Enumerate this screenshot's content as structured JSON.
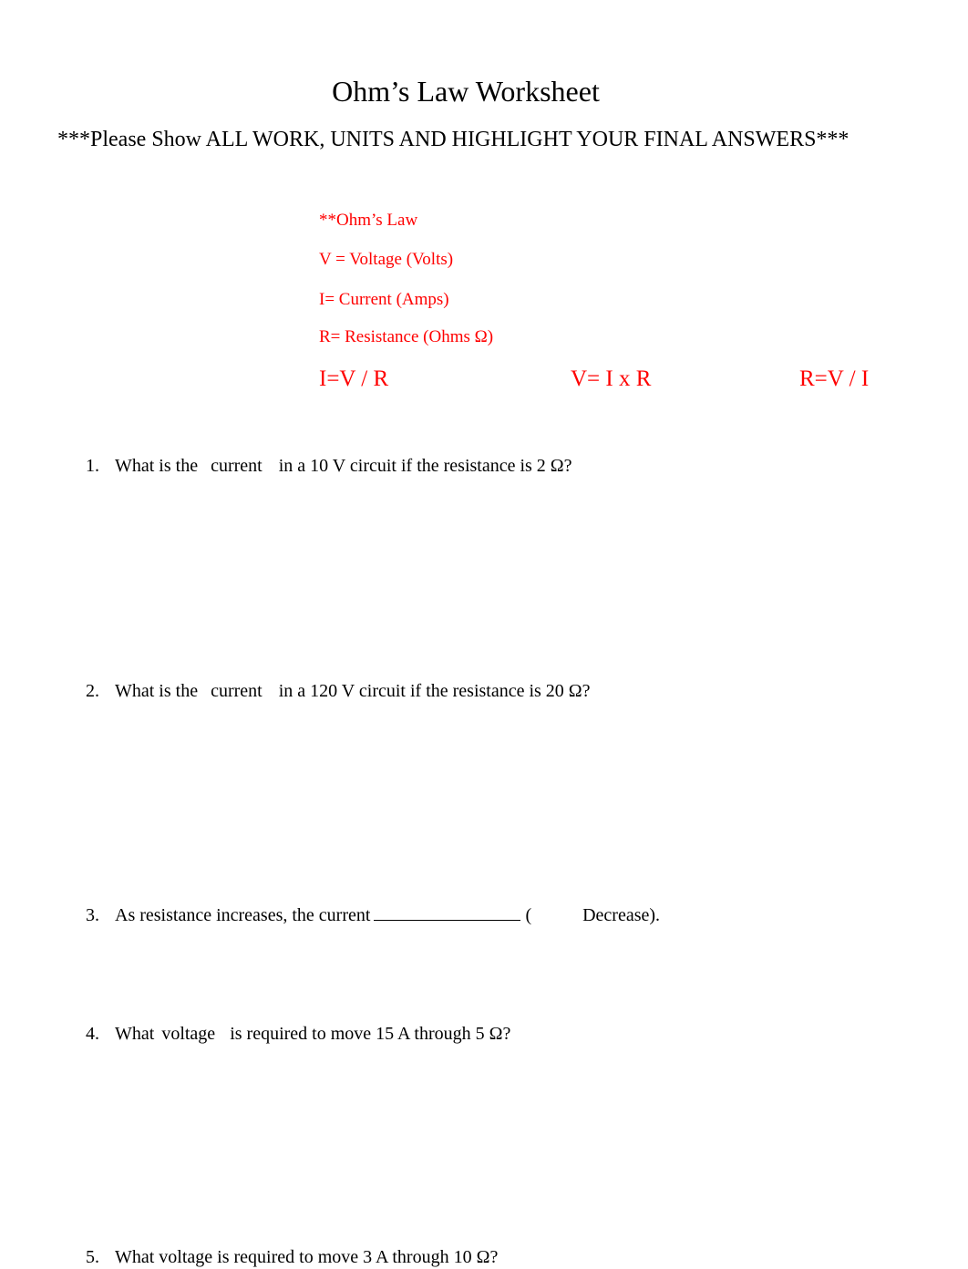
{
  "document": {
    "title": "Ohm’s Law Worksheet",
    "instructions": "***Please Show ALL WORK, UNITS AND HIGHLIGHT YOUR FINAL ANSWERS***"
  },
  "reference": {
    "heading": "**Ohm’s Law",
    "definitions": [
      "V = Voltage (Volts)",
      "I= Current (Amps)",
      "R= Resistance (Ohms Ω)"
    ],
    "formulas": [
      "I=V / R",
      "V= I x R",
      "R=V / I"
    ],
    "accent_color": "#ff0000"
  },
  "questions": [
    {
      "number": "1.",
      "parts": [
        "What is the",
        "current",
        "in a 10 V circuit if the resistance is 2 Ω?"
      ]
    },
    {
      "number": "2.",
      "parts": [
        "What is the",
        "current",
        "in a 120 V circuit if the resistance is 20 Ω?"
      ]
    },
    {
      "number": "3.",
      "parts": [
        "As resistance increases, the current",
        "(",
        "Decrease)."
      ]
    },
    {
      "number": "4.",
      "parts": [
        "What",
        "voltage",
        "is required to move 15 A through 5 Ω?"
      ]
    },
    {
      "number": "5.",
      "parts": [
        "What voltage is required to move 3 A through 10 Ω?"
      ]
    }
  ]
}
